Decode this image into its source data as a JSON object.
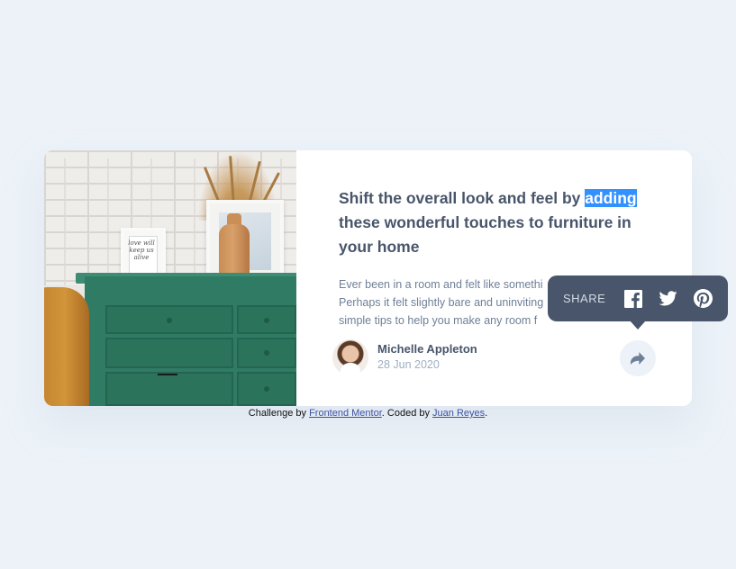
{
  "article": {
    "title_before": "Shift the overall look and feel by ",
    "title_highlight": "adding",
    "title_after": " these wonderful touches to furniture in your home",
    "description_lines": [
      "Ever been in a room and felt like somethi",
      "Perhaps it felt slightly bare and uninviting",
      "simple tips to help you make any room f"
    ],
    "image_frame_text": "love will keep us alive"
  },
  "author": {
    "name": "Michelle Appleton",
    "date": "28 Jun 2020"
  },
  "share": {
    "label": "SHARE",
    "icons": [
      "facebook-icon",
      "twitter-icon",
      "pinterest-icon"
    ],
    "button_icon": "share-icon"
  },
  "attribution": {
    "prefix": "Challenge by ",
    "challenge_link": "Frontend Mentor",
    "middle": ". Coded by ",
    "author_link": "Juan Reyes",
    "suffix": "."
  },
  "colors": {
    "background": "#ecf2f8",
    "card": "#ffffff",
    "title": "#48556a",
    "description": "#6e8098",
    "muted": "#9eafc2",
    "tooltip": "#48556a",
    "highlight": "#3390ff",
    "link": "#3e52a3"
  }
}
